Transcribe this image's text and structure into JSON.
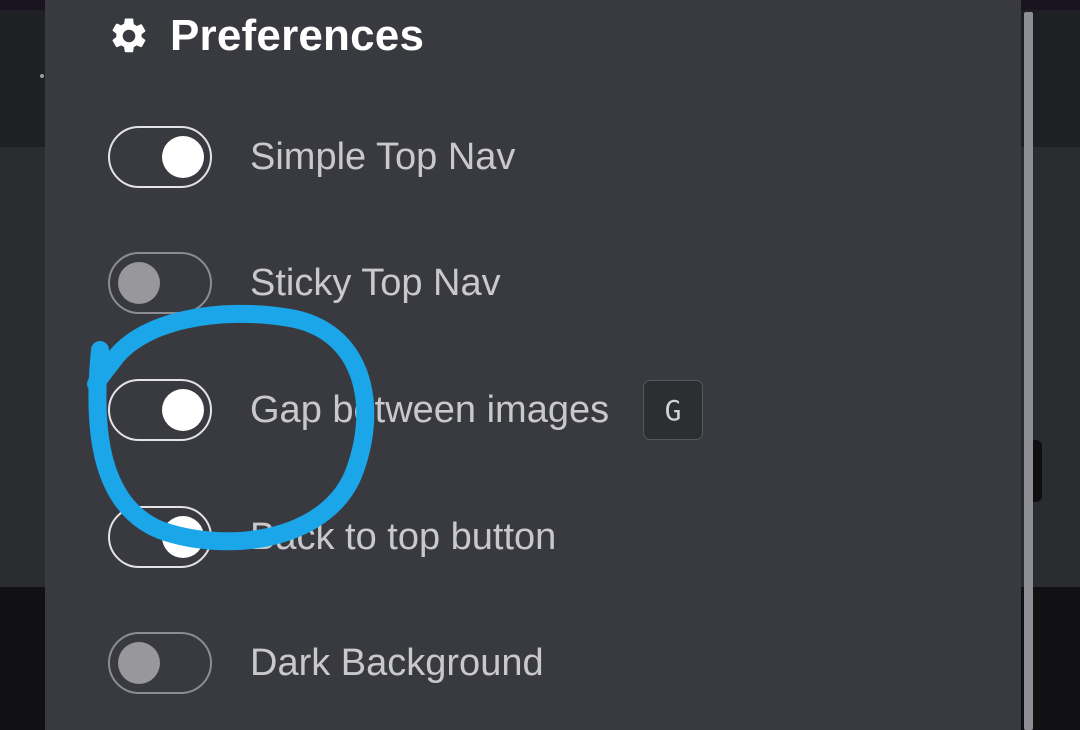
{
  "panel": {
    "title": "Preferences",
    "title_icon": "gear-icon"
  },
  "settings": [
    {
      "label": "Simple Top Nav",
      "enabled": true
    },
    {
      "label": "Sticky Top Nav",
      "enabled": false
    },
    {
      "label": "Gap between images",
      "enabled": true,
      "shortcut": "G"
    },
    {
      "label": "Back to top button",
      "enabled": true
    },
    {
      "label": "Dark Background",
      "enabled": false
    }
  ],
  "annotation": {
    "type": "hand-drawn circle",
    "color": "#1aa6e8",
    "target": "Gap between images toggle"
  }
}
